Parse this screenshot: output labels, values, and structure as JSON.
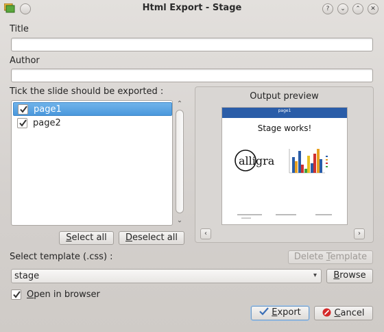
{
  "window": {
    "title": "Html Export - Stage"
  },
  "titlebar_buttons": {
    "help": "?",
    "minimize": "⌄",
    "maximize": "⌃",
    "close": "✕"
  },
  "form": {
    "title_label": "Title",
    "title_value": "",
    "author_label": "Author",
    "author_value": "",
    "slides_label": "Tick the slide should be exported :"
  },
  "slides": [
    {
      "label": "page1",
      "checked": true,
      "selected": true
    },
    {
      "label": "page2",
      "checked": true,
      "selected": false
    }
  ],
  "buttons": {
    "select_all": {
      "mnemonic": "S",
      "rest": "elect all"
    },
    "deselect_all": {
      "mnemonic": "D",
      "rest": "eselect all"
    },
    "delete_template": {
      "pre": "Delete ",
      "mnemonic": "T",
      "rest": "emplate"
    },
    "browse": {
      "mnemonic": "B",
      "rest": "rowse"
    },
    "export": {
      "mnemonic": "E",
      "rest": "xport"
    },
    "cancel": {
      "mnemonic": "C",
      "rest": "ancel"
    }
  },
  "preview": {
    "title": "Output preview",
    "slide_header": "page1",
    "slide_title": "Stage works!",
    "logo_text": "calligra"
  },
  "template": {
    "label": "Select template (.css) :",
    "selected": "stage"
  },
  "open_in_browser": {
    "mnemonic": "O",
    "rest": "pen in browser",
    "checked": true
  },
  "colors": {
    "selection": "#4a98dc",
    "slide_header": "#2a5da8",
    "export_icon": "#3b6fb6",
    "cancel_icon": "#d42a2a"
  }
}
